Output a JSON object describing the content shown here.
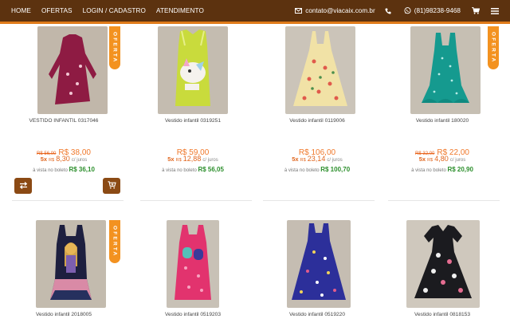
{
  "nav": {
    "items": [
      "HOME",
      "OFERTAS",
      "LOGIN / CADASTRO",
      "ATENDIMENTO"
    ]
  },
  "contact": {
    "email": "contato@viacaix.com.br",
    "phone_icon": "phone-icon",
    "whatsapp": "(81)98238-9468",
    "cart_icon": "cart-icon",
    "menu_icon": "menu-icon"
  },
  "colors": {
    "topbar": "#5c320f",
    "accent": "#f39220",
    "price": "#f0782a",
    "boleto": "#2c8f2c",
    "button": "#8b4a14"
  },
  "ribbon_label": "OFERTA",
  "products": [
    {
      "name": "VESTIDO INFANTIL 0317046",
      "old_price": "R$ 56,00",
      "price": "R$ 38,00",
      "installments": "5x",
      "inst_currency": "R$",
      "inst_value": "8,30",
      "inst_suffix": "c/ juros",
      "boleto_label": "à vista no boleto",
      "boleto_price": "R$ 36,10",
      "offer": true,
      "show_buttons": true
    },
    {
      "name": "Vestido infantil 0319251",
      "old_price": "",
      "price": "R$ 59,00",
      "installments": "5x",
      "inst_currency": "R$",
      "inst_value": "12,88",
      "inst_suffix": "c/ juros",
      "boleto_label": "à vista no boleto",
      "boleto_price": "R$ 56,05",
      "offer": false,
      "show_buttons": false
    },
    {
      "name": "Vestido infantil 0119006",
      "old_price": "",
      "price": "R$ 106,00",
      "installments": "5x",
      "inst_currency": "R$",
      "inst_value": "23,14",
      "inst_suffix": "c/ juros",
      "boleto_label": "à vista no boleto",
      "boleto_price": "R$ 100,70",
      "offer": false,
      "show_buttons": false
    },
    {
      "name": "Vestido infantil 180020",
      "old_price": "R$ 32,00",
      "price": "R$ 22,00",
      "installments": "5x",
      "inst_currency": "R$",
      "inst_value": "4,80",
      "inst_suffix": "c/ juros",
      "boleto_label": "à vista no boleto",
      "boleto_price": "R$ 20,90",
      "offer": true,
      "show_buttons": false
    },
    {
      "name": "Vestido infantil 2018005",
      "offer": true
    },
    {
      "name": "Vestido infantil 0519203",
      "offer": false
    },
    {
      "name": "Vestido infantil 0519220",
      "offer": false
    },
    {
      "name": "Vestido infantil 0818153",
      "offer": false
    }
  ]
}
